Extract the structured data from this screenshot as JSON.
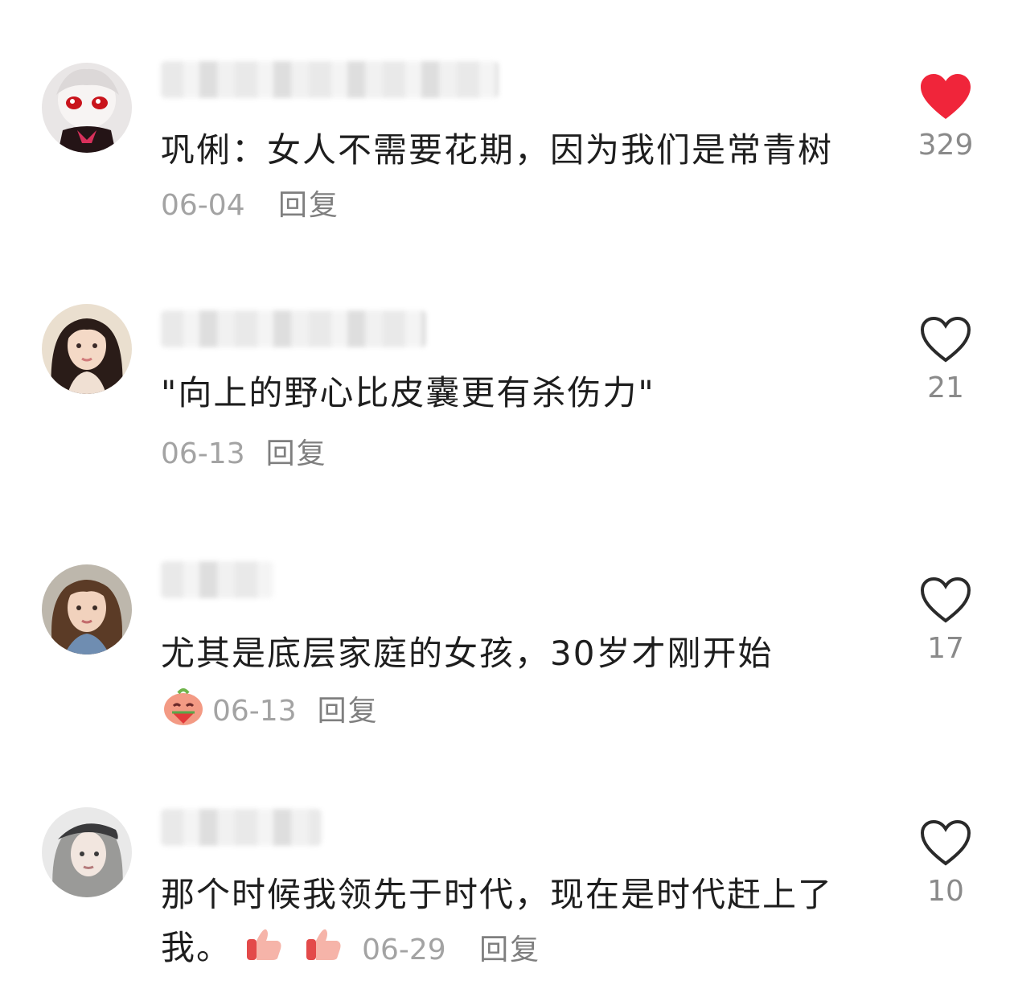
{
  "comments": [
    {
      "text": "巩俐：女人不需要花期，因为我们是常青树",
      "date": "06-04",
      "reply": "回复",
      "likes": "329",
      "liked": true,
      "emojis": []
    },
    {
      "text": "\"向上的野心比皮囊更有杀伤力\"",
      "date": "06-13",
      "reply": "回复",
      "likes": "21",
      "liked": false,
      "emojis": []
    },
    {
      "text": "尤其是底层家庭的女孩，30岁才刚开始",
      "date": "06-13",
      "reply": "回复",
      "likes": "17",
      "liked": false,
      "emojis": [
        "watermelon-eating-emoji"
      ]
    },
    {
      "text": "那个时候我领先于时代，现在是时代赶上了我。",
      "date": "06-29",
      "reply": "回复",
      "likes": "10",
      "liked": false,
      "emojis": [
        "thumbs-up-emoji",
        "thumbs-up-emoji"
      ]
    }
  ],
  "colors": {
    "liked_heart": "#f0253a",
    "heart_outline": "#2a2a2a",
    "date": "#a3a3a3",
    "reply": "#7f7f7f",
    "count": "#8a8a8a"
  }
}
